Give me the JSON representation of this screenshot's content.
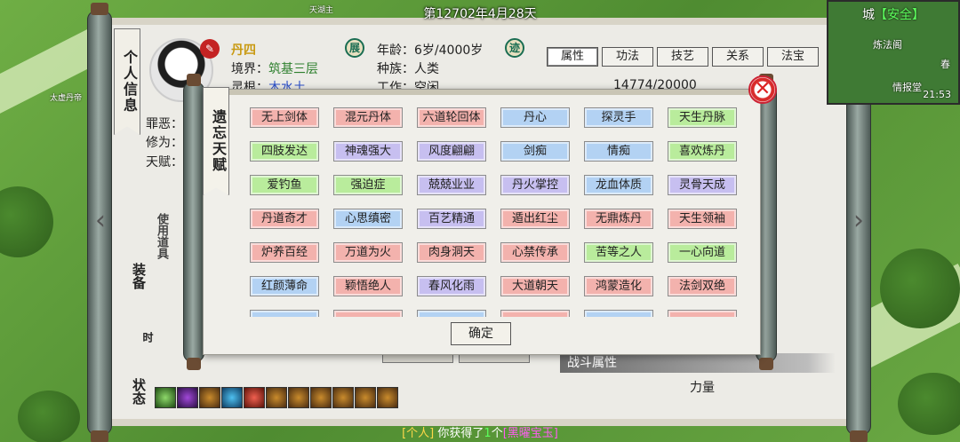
{
  "header": {
    "date": "第12702年4月28天"
  },
  "world": {
    "labels": [
      "太虚丹帝",
      "天湖主"
    ]
  },
  "minimap": {
    "city_prefix": "城",
    "status": "【安全】",
    "spots": [
      "炼法阁",
      "情报堂",
      "春"
    ],
    "time": "21:53"
  },
  "info_panel": {
    "title": "个人信息",
    "name": "丹四",
    "realm_label": "境界：",
    "realm_value": "筑基三层",
    "root_label": "灵根：",
    "root_value": "木水土",
    "evil_label": "罪恶：",
    "cultivation_label": "修为：4",
    "talent_label": "天赋：",
    "age_label": "年龄：",
    "age_value": "6岁/4000岁",
    "race_label": "种族：",
    "race_value": "人类",
    "work_label": "工作：",
    "work_value": "空闲",
    "seal_left": "展",
    "seal_right": "迹",
    "stat_value": "14774/20000",
    "tabs": [
      "属性",
      "功法",
      "技艺",
      "关系",
      "法宝"
    ],
    "side_labels": {
      "use_item": "使用道具",
      "equip": "装备",
      "status": "状态",
      "time_label": "时"
    },
    "combat_label": "战斗属性",
    "strength_label": "力量"
  },
  "talent_dialog": {
    "title": "遗忘天赋",
    "confirm_label": "确定",
    "talents": [
      {
        "name": "无上剑体",
        "color": "pink"
      },
      {
        "name": "混元丹体",
        "color": "pink"
      },
      {
        "name": "六道轮回体",
        "color": "pink"
      },
      {
        "name": "丹心",
        "color": "blue"
      },
      {
        "name": "探灵手",
        "color": "blue"
      },
      {
        "name": "天生丹脉",
        "color": "green"
      },
      {
        "name": "四肢发达",
        "color": "green"
      },
      {
        "name": "神魂强大",
        "color": "purple"
      },
      {
        "name": "风度翩翩",
        "color": "purple"
      },
      {
        "name": "剑痴",
        "color": "blue"
      },
      {
        "name": "情痴",
        "color": "blue"
      },
      {
        "name": "喜欢炼丹",
        "color": "green"
      },
      {
        "name": "爱钓鱼",
        "color": "green"
      },
      {
        "name": "强迫症",
        "color": "green"
      },
      {
        "name": "兢兢业业",
        "color": "purple"
      },
      {
        "name": "丹火掌控",
        "color": "purple"
      },
      {
        "name": "龙血体质",
        "color": "blue"
      },
      {
        "name": "灵骨天成",
        "color": "purple"
      },
      {
        "name": "丹道奇才",
        "color": "pink"
      },
      {
        "name": "心思缜密",
        "color": "blue"
      },
      {
        "name": "百艺精通",
        "color": "purple"
      },
      {
        "name": "遁出红尘",
        "color": "pink"
      },
      {
        "name": "无鼎炼丹",
        "color": "pink"
      },
      {
        "name": "天生领袖",
        "color": "pink"
      },
      {
        "name": "炉养百经",
        "color": "pink"
      },
      {
        "name": "万道为火",
        "color": "pink"
      },
      {
        "name": "肉身洞天",
        "color": "pink"
      },
      {
        "name": "心禁传承",
        "color": "pink"
      },
      {
        "name": "苦等之人",
        "color": "green"
      },
      {
        "name": "一心向道",
        "color": "green"
      },
      {
        "name": "红颜薄命",
        "color": "blue"
      },
      {
        "name": "颖悟绝人",
        "color": "pink"
      },
      {
        "name": "春风化雨",
        "color": "purple"
      },
      {
        "name": "大道朝天",
        "color": "pink"
      },
      {
        "name": "鸿蒙造化",
        "color": "pink"
      },
      {
        "name": "法剑双绝",
        "color": "pink"
      },
      {
        "name": "",
        "color": "blue"
      },
      {
        "name": "",
        "color": "pink"
      },
      {
        "name": "",
        "color": "blue"
      },
      {
        "name": "",
        "color": "pink"
      },
      {
        "name": "",
        "color": "blue"
      },
      {
        "name": "",
        "color": "pink"
      }
    ]
  },
  "chat": {
    "channel": "[个人]",
    "text_before": "你获得了",
    "count": "1",
    "text_mid": "个",
    "item": "[黑曜宝玉]"
  }
}
